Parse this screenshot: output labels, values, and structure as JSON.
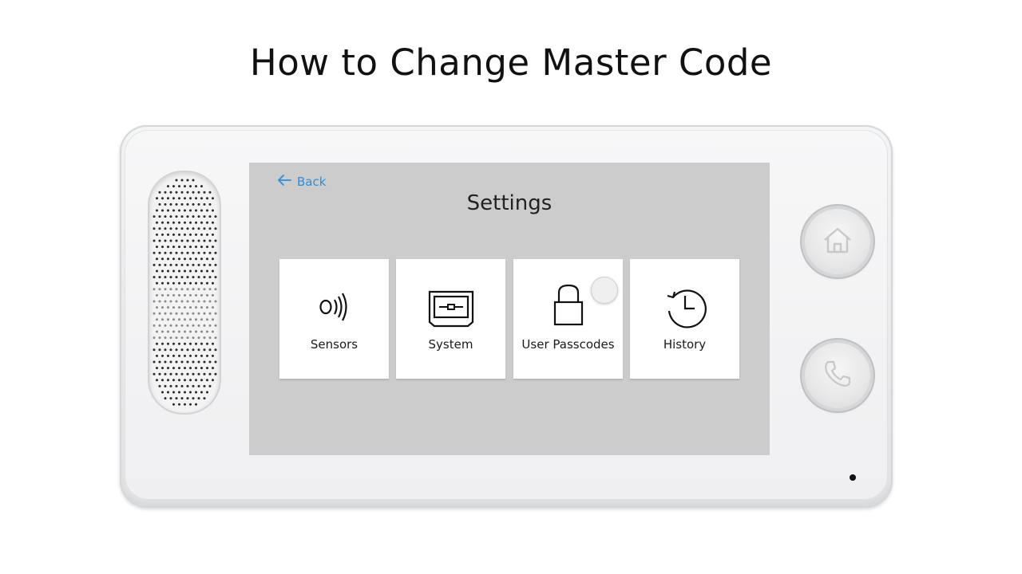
{
  "page": {
    "title": "How to Change Master Code"
  },
  "screen": {
    "back_label": "Back",
    "title": "Settings",
    "tiles": [
      {
        "label": "Sensors",
        "icon": "sensor-signal-icon"
      },
      {
        "label": "System",
        "icon": "system-panel-icon"
      },
      {
        "label": "User Passcodes",
        "icon": "padlock-icon"
      },
      {
        "label": "History",
        "icon": "history-clock-icon"
      }
    ]
  },
  "hardware_buttons": [
    {
      "icon": "home-icon"
    },
    {
      "icon": "phone-icon"
    }
  ],
  "colors": {
    "accent": "#2f8fd6",
    "screen_background": "#cccccc",
    "tile_background": "#ffffff",
    "device_body": "#efeff1"
  }
}
